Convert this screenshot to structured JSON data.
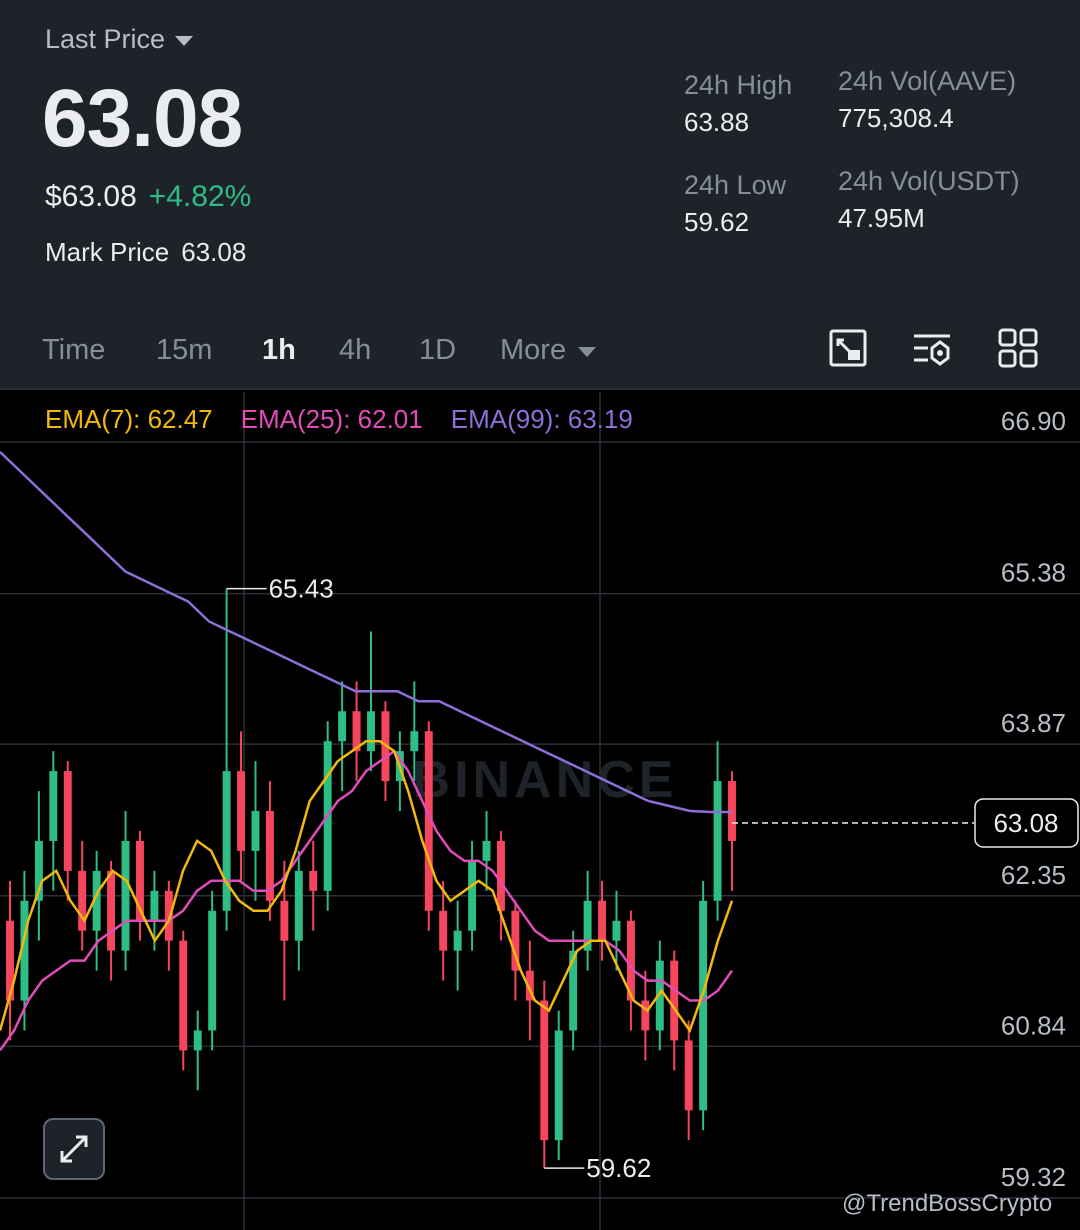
{
  "header": {
    "last_price_label": "Last Price",
    "price": "63.08",
    "usd_price": "$63.08",
    "change_pct": "+4.82%",
    "mark_price_label": "Mark Price",
    "mark_price": "63.08"
  },
  "stats": {
    "high_label": "24h High",
    "high_value": "63.88",
    "low_label": "24h Low",
    "low_value": "59.62",
    "vol_base_label": "24h Vol(AAVE)",
    "vol_base_value": "775,308.4",
    "vol_quote_label": "24h Vol(USDT)",
    "vol_quote_value": "47.95M"
  },
  "toolbar": {
    "timeframes": [
      "Time",
      "15m",
      "1h",
      "4h",
      "1D"
    ],
    "active": "1h",
    "more_label": "More",
    "icons": [
      "fullscreen-chart-icon",
      "indicator-settings-icon",
      "grid-layout-icon"
    ]
  },
  "indicators": {
    "ema7": "EMA(7): 62.47",
    "ema25": "EMA(25): 62.01",
    "ema99": "EMA(99): 63.19"
  },
  "colors": {
    "up": "#2EBD85",
    "down": "#F6465D",
    "ema7": "#F0B90B",
    "ema25": "#E04CB8",
    "ema99": "#8E6FD8",
    "header_bg": "#1E2329"
  },
  "chart_data": {
    "type": "candlestick",
    "y_ticks": [
      "66.90",
      "65.38",
      "63.87",
      "62.35",
      "60.84",
      "59.32"
    ],
    "ylim": [
      59.2,
      67.1
    ],
    "current_price_label": "63.08",
    "current_price": 63.08,
    "high_marker": "65.43",
    "high_marker_value": 65.43,
    "low_marker": "59.62",
    "low_marker_value": 59.62,
    "watermark": "BINANCE",
    "attribution": "@TrendBossCrypto",
    "ema7": [
      61.0,
      61.5,
      62.1,
      62.5,
      62.6,
      62.3,
      62.1,
      62.4,
      62.6,
      62.5,
      62.2,
      61.9,
      62.1,
      62.6,
      62.9,
      62.8,
      62.5,
      62.3,
      62.2,
      62.2,
      62.4,
      62.8,
      63.3,
      63.5,
      63.7,
      63.8,
      63.9,
      63.9,
      63.8,
      63.4,
      62.9,
      62.5,
      62.3,
      62.4,
      62.5,
      62.4,
      62.0,
      61.6,
      61.3,
      61.2,
      61.5,
      61.8,
      61.9,
      61.9,
      61.6,
      61.3,
      61.2,
      61.4,
      61.2,
      61.0,
      61.4,
      61.9,
      62.3
    ],
    "ema25": [
      60.8,
      61.0,
      61.3,
      61.5,
      61.6,
      61.7,
      61.7,
      61.9,
      62.0,
      62.1,
      62.1,
      62.1,
      62.1,
      62.2,
      62.4,
      62.5,
      62.5,
      62.5,
      62.4,
      62.4,
      62.5,
      62.7,
      62.9,
      63.1,
      63.3,
      63.4,
      63.6,
      63.7,
      63.8,
      63.6,
      63.3,
      63.0,
      62.8,
      62.7,
      62.7,
      62.6,
      62.4,
      62.2,
      62.0,
      61.9,
      61.9,
      61.9,
      61.9,
      61.9,
      61.8,
      61.6,
      61.5,
      61.5,
      61.4,
      61.3,
      61.3,
      61.4,
      61.6
    ],
    "ema99": [
      66.8,
      66.6,
      66.4,
      66.2,
      66.0,
      65.8,
      65.6,
      65.5,
      65.4,
      65.3,
      65.1,
      65.0,
      64.9,
      64.8,
      64.7,
      64.6,
      64.5,
      64.4,
      64.4,
      64.4,
      64.3,
      64.3,
      64.2,
      64.1,
      64.0,
      63.9,
      63.8,
      63.7,
      63.6,
      63.5,
      63.4,
      63.3,
      63.25,
      63.2,
      63.19,
      63.19
    ],
    "candles": [
      [
        62.1,
        62.5,
        60.9,
        61.3
      ],
      [
        61.3,
        62.6,
        61.0,
        62.3
      ],
      [
        62.3,
        63.4,
        61.9,
        62.9
      ],
      [
        62.9,
        63.8,
        62.4,
        63.6
      ],
      [
        63.6,
        63.7,
        62.3,
        62.6
      ],
      [
        62.6,
        62.9,
        61.8,
        62.0
      ],
      [
        62.0,
        62.8,
        61.6,
        62.6
      ],
      [
        62.6,
        62.7,
        61.5,
        61.8
      ],
      [
        61.8,
        63.2,
        61.6,
        62.9
      ],
      [
        62.9,
        63.0,
        61.9,
        62.1
      ],
      [
        62.1,
        62.6,
        61.8,
        62.4
      ],
      [
        62.4,
        62.5,
        61.6,
        61.9
      ],
      [
        61.9,
        62.0,
        60.6,
        60.8
      ],
      [
        60.8,
        61.2,
        60.4,
        61.0
      ],
      [
        61.0,
        62.4,
        60.8,
        62.2
      ],
      [
        62.2,
        65.43,
        62.0,
        63.6
      ],
      [
        63.6,
        64.0,
        62.5,
        62.8
      ],
      [
        62.8,
        63.7,
        62.3,
        63.2
      ],
      [
        63.2,
        63.5,
        62.1,
        62.3
      ],
      [
        62.3,
        62.7,
        61.3,
        61.9
      ],
      [
        61.9,
        62.8,
        61.6,
        62.6
      ],
      [
        62.6,
        62.9,
        62.0,
        62.4
      ],
      [
        62.4,
        64.1,
        62.2,
        63.9
      ],
      [
        63.9,
        64.5,
        63.4,
        64.2
      ],
      [
        64.2,
        64.5,
        63.5,
        63.8
      ],
      [
        63.8,
        65.0,
        63.6,
        64.2
      ],
      [
        64.2,
        64.3,
        63.3,
        63.5
      ],
      [
        63.5,
        64.0,
        63.2,
        63.8
      ],
      [
        63.8,
        64.5,
        63.5,
        64.0
      ],
      [
        64.0,
        64.1,
        62.0,
        62.2
      ],
      [
        62.2,
        62.5,
        61.5,
        61.8
      ],
      [
        61.8,
        62.3,
        61.4,
        62.0
      ],
      [
        62.0,
        62.9,
        61.8,
        62.7
      ],
      [
        62.7,
        63.2,
        62.4,
        62.9
      ],
      [
        62.9,
        63.0,
        61.9,
        62.2
      ],
      [
        62.2,
        62.3,
        61.3,
        61.6
      ],
      [
        61.6,
        61.9,
        60.9,
        61.3
      ],
      [
        61.3,
        61.5,
        59.62,
        59.9
      ],
      [
        59.9,
        61.2,
        59.7,
        61.0
      ],
      [
        61.0,
        62.0,
        60.8,
        61.8
      ],
      [
        61.8,
        62.6,
        61.6,
        62.3
      ],
      [
        62.3,
        62.5,
        61.7,
        61.9
      ],
      [
        61.9,
        62.4,
        61.6,
        62.1
      ],
      [
        62.1,
        62.2,
        61.0,
        61.3
      ],
      [
        61.3,
        61.6,
        60.7,
        61.0
      ],
      [
        61.0,
        61.9,
        60.8,
        61.7
      ],
      [
        61.7,
        61.8,
        60.6,
        60.9
      ],
      [
        60.9,
        61.1,
        59.9,
        60.2
      ],
      [
        60.2,
        62.5,
        60.0,
        62.3
      ],
      [
        62.3,
        63.9,
        62.1,
        63.5
      ],
      [
        63.5,
        63.6,
        62.4,
        62.9
      ]
    ]
  },
  "misc": {
    "expand_icon": "expand-arrows-icon"
  }
}
